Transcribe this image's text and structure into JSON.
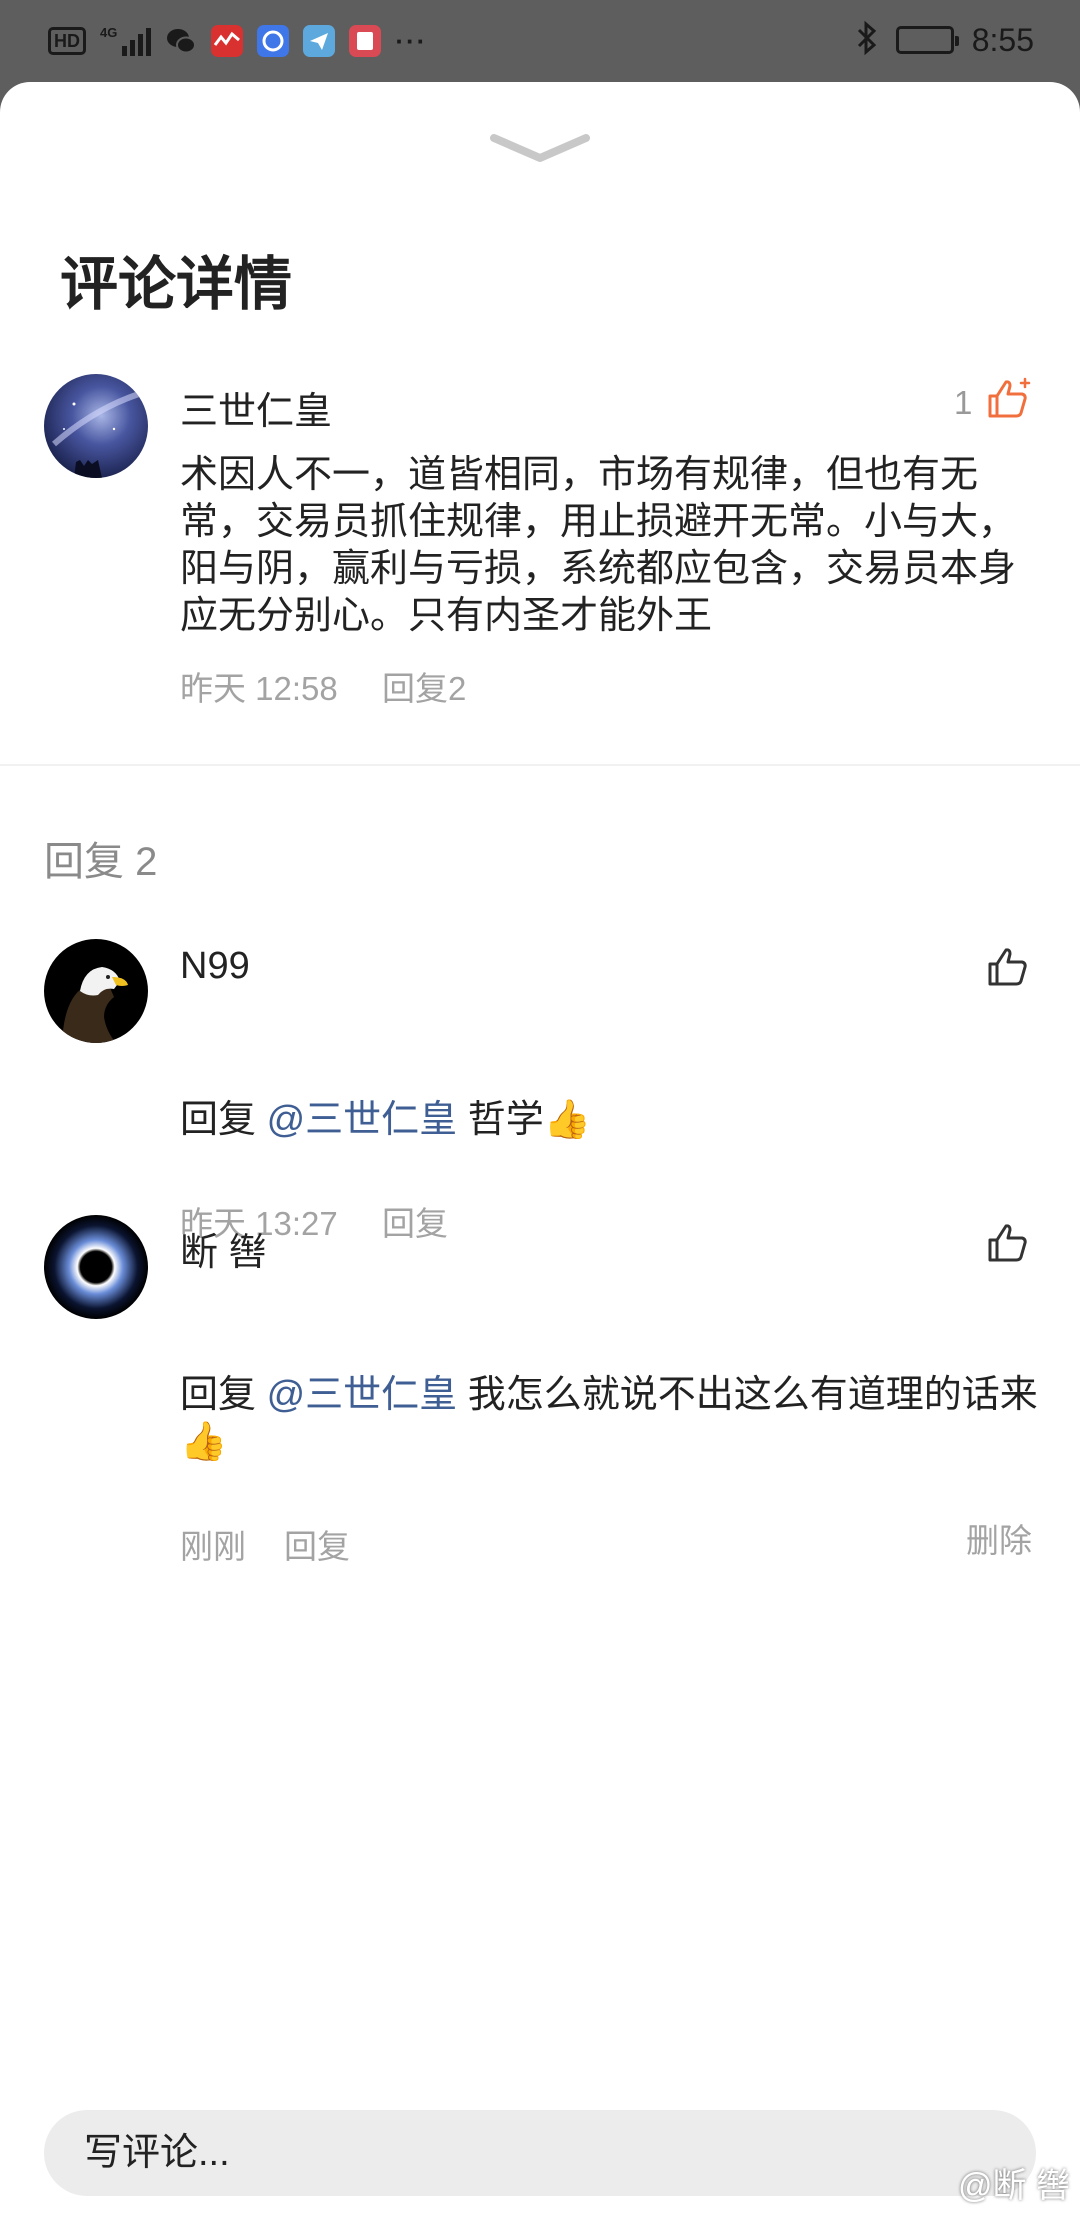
{
  "status_bar": {
    "hd": "HD",
    "network": "4G",
    "more": "···",
    "time": "8:55"
  },
  "page": {
    "title": "评论详情"
  },
  "main_comment": {
    "username": "三世仁皇",
    "text": "术因人不一，道皆相同，市场有规律，但也有无常，交易员抓住规律，用止损避开无常。小与大，阳与阴，赢利与亏损，系统都应包含，交易员本身应无分别心。只有内圣才能外王",
    "time": "昨天 12:58",
    "reply_label": "回复2",
    "like_count": "1",
    "like_color": "#f06f3c"
  },
  "replies_section": {
    "label": "回复 2"
  },
  "replies": [
    {
      "username": "N99",
      "reply_prefix": "回复",
      "mention": "@三世仁皇",
      "text": " 哲学👍",
      "time": "昨天 13:27",
      "reply_label": "回复"
    },
    {
      "username": "断 辔",
      "reply_prefix": "回复",
      "mention": "@三世仁皇",
      "text": " 我怎么就说不出这么有道理的话来👍",
      "time": "刚刚",
      "reply_label": "回复",
      "delete_label": "删除"
    }
  ],
  "input": {
    "placeholder": "写评论..."
  },
  "watermark": "@断 辔",
  "colors": {
    "mention": "#3f5f94",
    "meta": "#a3a3a3",
    "like_active": "#f06f3c"
  }
}
